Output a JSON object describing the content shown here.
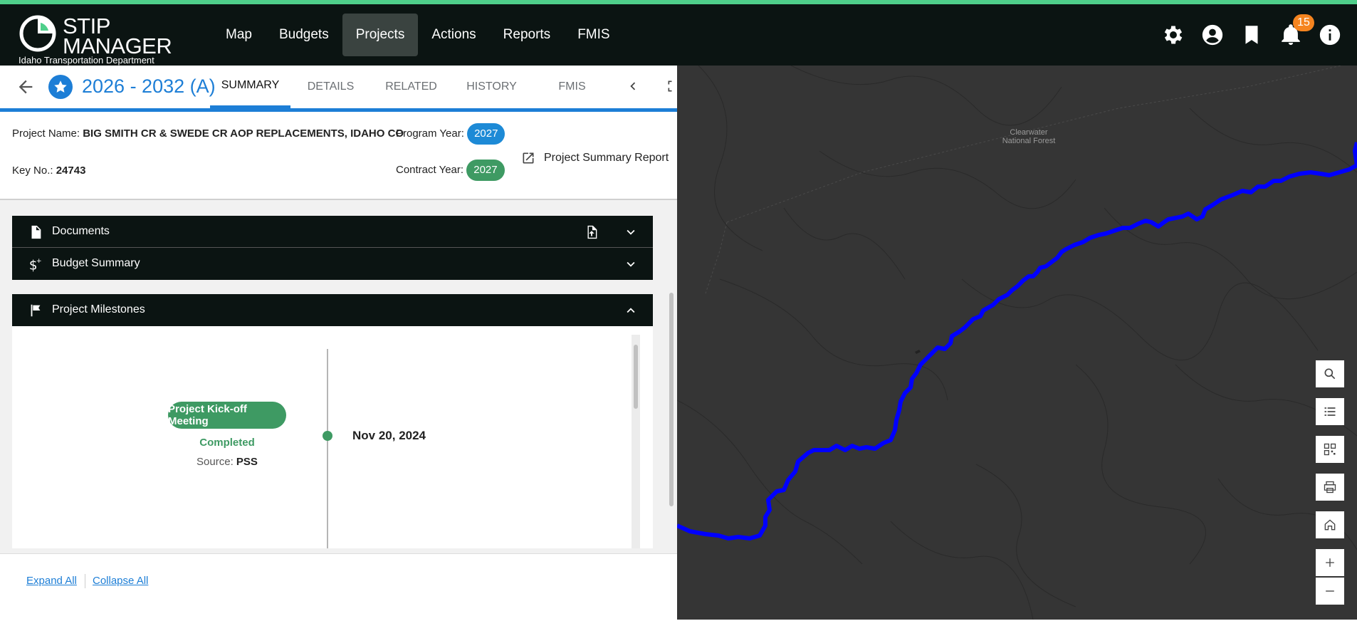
{
  "app": {
    "title_line1": "STIP",
    "title_line2": "MANAGER",
    "subtitle": "Idaho Transportation Department",
    "accent_color": "#4fcf8a"
  },
  "nav": {
    "items": [
      {
        "label": "Map"
      },
      {
        "label": "Budgets"
      },
      {
        "label": "Projects",
        "active": true
      },
      {
        "label": "Actions"
      },
      {
        "label": "Reports"
      },
      {
        "label": "FMIS"
      }
    ]
  },
  "top_icons": {
    "icons": [
      "gear-icon",
      "account-icon",
      "bookmark-icon",
      "bell-icon",
      "info-icon"
    ],
    "notification_count": "15"
  },
  "project_header": {
    "program": "2026 - 2032 (A)",
    "tabs": [
      {
        "label": "SUMMARY",
        "active": true
      },
      {
        "label": "DETAILS"
      },
      {
        "label": "RELATED"
      },
      {
        "label": "HISTORY"
      },
      {
        "label": "FMIS"
      }
    ]
  },
  "project_info": {
    "name_label": "Project Name:",
    "name_value": "BIG SMITH CR & SWEDE CR AOP REPLACEMENTS, IDAHO CO",
    "key_label": "Key No.:",
    "key_value": "24743",
    "program_year_label": "Program Year:",
    "program_year_value": "2027",
    "contract_year_label": "Contract Year:",
    "contract_year_value": "2027",
    "report_link": "Project Summary Report"
  },
  "accordions": {
    "documents": "Documents",
    "budget_summary": "Budget Summary",
    "project_milestones": "Project Milestones"
  },
  "milestone": {
    "title": "Project Kick-off Meeting",
    "status": "Completed",
    "source_label": "Source:",
    "source_value": "PSS",
    "date": "Nov 20, 2024"
  },
  "footer": {
    "expand_all": "Expand All",
    "collapse_all": "Collapse All"
  },
  "map": {
    "label": "Clearwater National Forest",
    "route_color": "#0000ff",
    "tools": [
      "search-icon",
      "legend-icon",
      "qr-icon",
      "print-icon",
      "home-icon",
      "zoom-in-icon",
      "zoom-out-icon"
    ]
  }
}
